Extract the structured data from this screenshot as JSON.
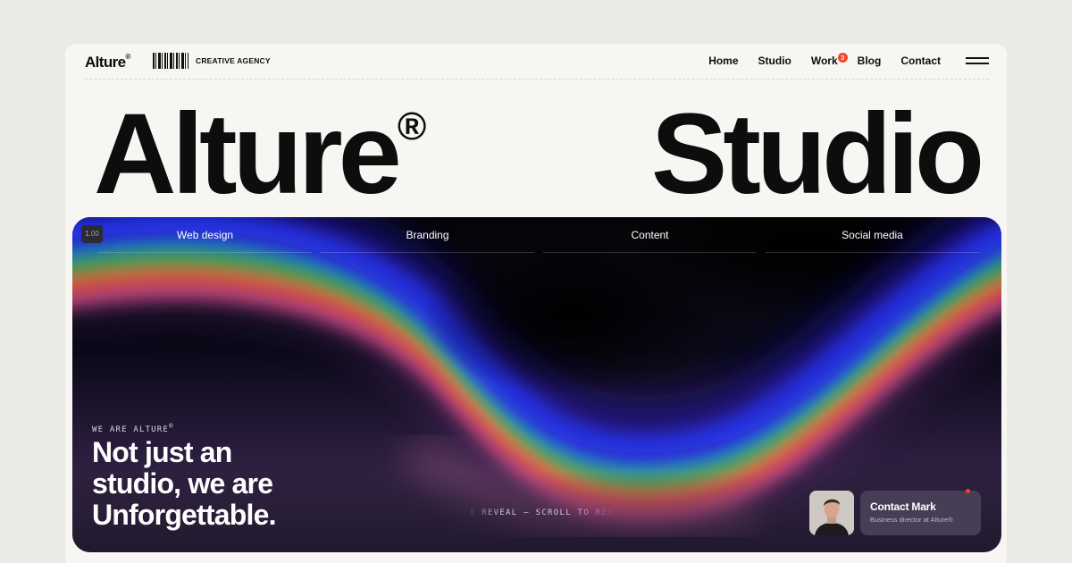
{
  "header": {
    "logo": "Alture",
    "logo_mark": "®",
    "tagline": "CREATIVE AGENCY",
    "nav": [
      {
        "label": "Home"
      },
      {
        "label": "Studio"
      },
      {
        "label": "Work",
        "badge": "3"
      },
      {
        "label": "Blog"
      },
      {
        "label": "Contact"
      }
    ]
  },
  "hero": {
    "title_left": "Alture",
    "title_mark": "®",
    "title_right": "Studio"
  },
  "card": {
    "chip": "1.00",
    "services": [
      "Web design",
      "Branding",
      "Content",
      "Social media"
    ],
    "eyebrow": "WE ARE ALTURE",
    "eyebrow_mark": "®",
    "headline_lines": [
      "Not just an",
      "studio, we are",
      "Unforgettable."
    ],
    "scroll_text": "TO REVEAL — SCROLL TO REVEAL",
    "contact": {
      "name": "Contact Mark",
      "role": "Business director at Alture®"
    }
  },
  "colors": {
    "page_bg": "#ebeae5",
    "frame_bg": "#f7f6f2",
    "badge": "#f0452a",
    "status_dot": "#ff3b2f"
  },
  "icons": [
    "barcode-icon",
    "hamburger-menu-icon",
    "status-dot-icon"
  ]
}
